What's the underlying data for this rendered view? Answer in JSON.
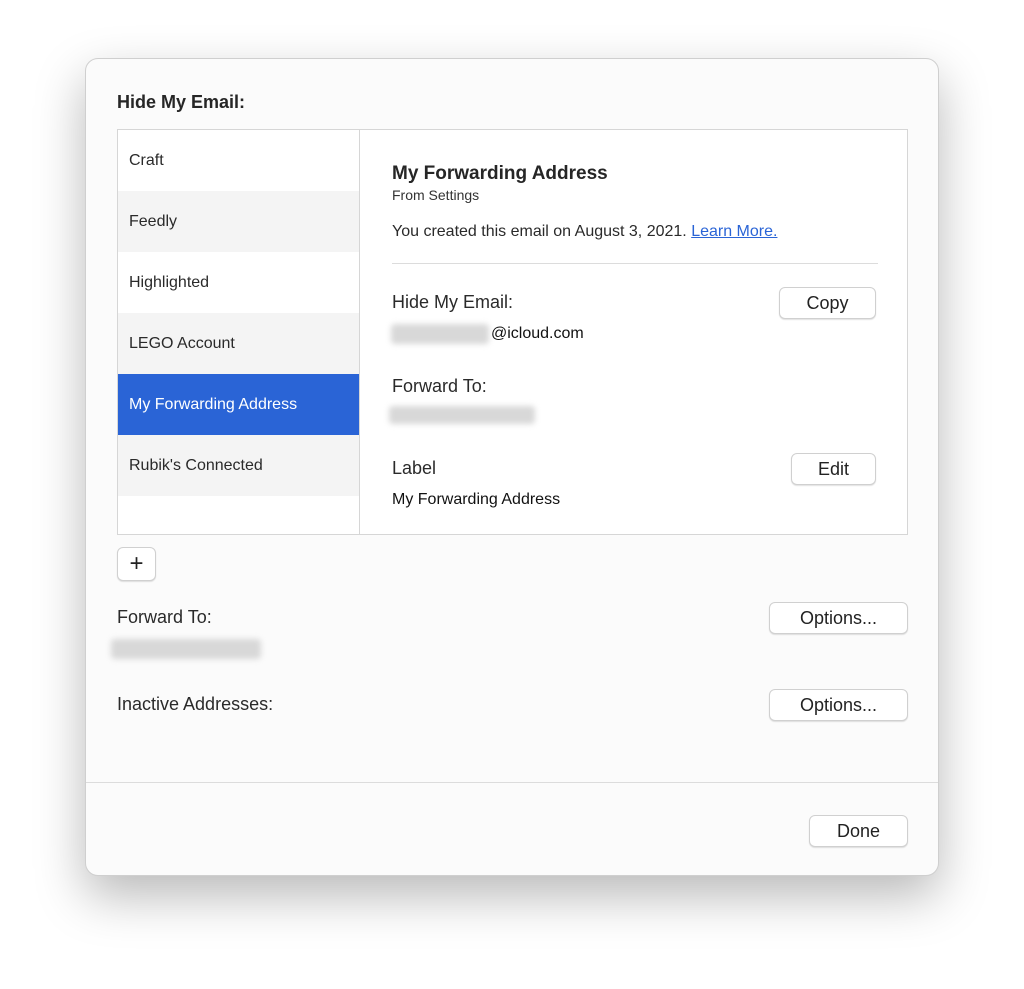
{
  "title": "Hide My Email:",
  "sidebar": {
    "items": [
      {
        "label": "Craft"
      },
      {
        "label": "Feedly"
      },
      {
        "label": "Highlighted"
      },
      {
        "label": "LEGO Account"
      },
      {
        "label": "My Forwarding Address",
        "selected": true
      },
      {
        "label": "Rubik's Connected"
      }
    ]
  },
  "detail": {
    "name": "My Forwarding Address",
    "source": "From Settings",
    "created": "You created this email on August 3, 2021.",
    "learn_more": "Learn More.",
    "hide_label": "Hide My Email:",
    "email_domain": "@icloud.com",
    "copy": "Copy",
    "forward_label": "Forward To:",
    "label_label": "Label",
    "edit": "Edit",
    "label_value": "My Forwarding Address"
  },
  "add_button": "+",
  "forward": {
    "label": "Forward To:",
    "options": "Options..."
  },
  "inactive": {
    "label": "Inactive Addresses:",
    "options": "Options..."
  },
  "done": "Done",
  "colors": {
    "selection": "#2a64d6",
    "link": "#2a64d6"
  }
}
